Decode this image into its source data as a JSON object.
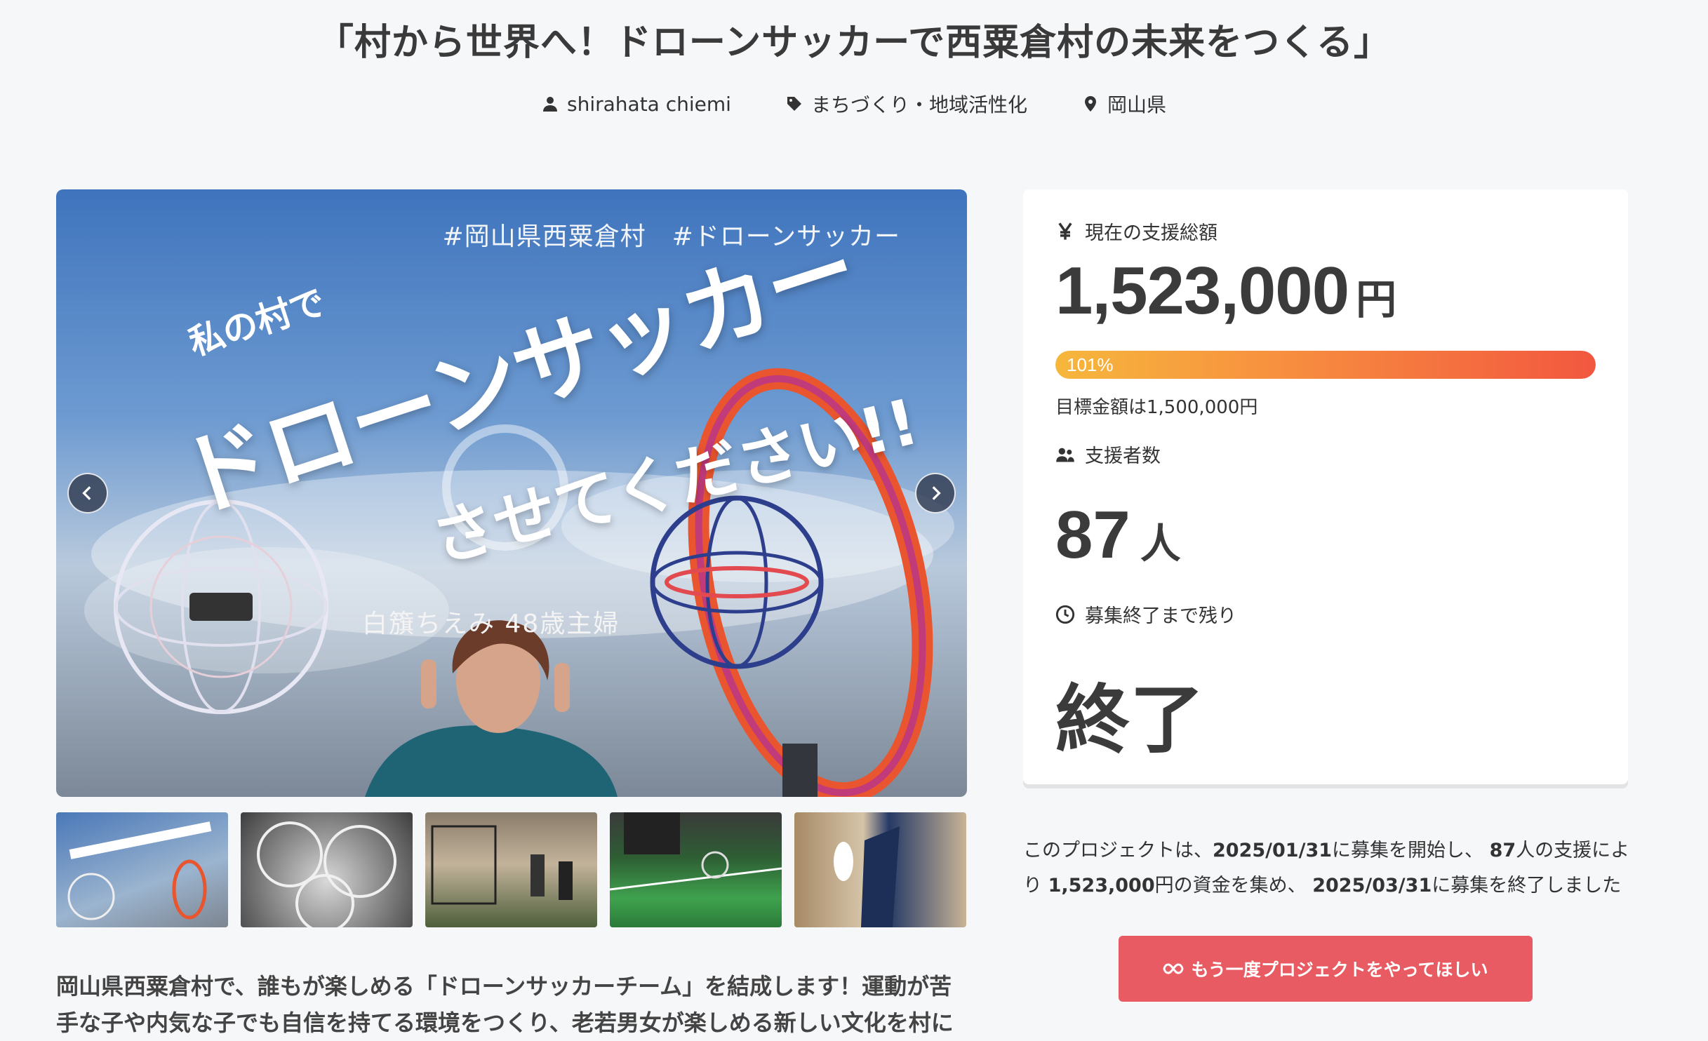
{
  "project": {
    "title": "「村から世界へ！ドローンサッカーで西粟倉村の未来をつくる」",
    "owner": "shirahata chiemi",
    "category": "まちづくり・地域活性化",
    "location": "岡山県"
  },
  "hero": {
    "tags": "#岡山県西粟倉村　#ドローンサッカー",
    "sub": "私の村で",
    "main": "ドローンサッカー",
    "main2": "させてください!!",
    "caption": "白籏ちえみ 48歳主婦",
    "prev_icon": "chevron-left-icon",
    "next_icon": "chevron-right-icon"
  },
  "thumbnails": [
    {
      "name": "thumbnail-1"
    },
    {
      "name": "thumbnail-2"
    },
    {
      "name": "thumbnail-3"
    },
    {
      "name": "thumbnail-4"
    },
    {
      "name": "thumbnail-5"
    }
  ],
  "description": "岡山県西粟倉村で、誰もが楽しめる「ドローンサッカーチーム」を結成します！運動が苦手な子や内気な子でも自信を持てる環境をつくり、老若男女が楽しめる新しい文化を村に",
  "stats": {
    "total_label": "現在の支援総額",
    "total_icon": "yen-icon",
    "total_value": "1,523,000",
    "total_unit": "円",
    "progress_percent": 101,
    "progress_label": "101%",
    "goal_text": "目標金額は1,500,000円",
    "backers_label": "支援者数",
    "backers_icon": "users-icon",
    "backers_value": "87",
    "backers_unit": "人",
    "remaining_label": "募集終了まで残り",
    "remaining_icon": "clock-icon",
    "remaining_value": "終了"
  },
  "summary": {
    "part1": "このプロジェクトは、",
    "start_date": "2025/01/31",
    "part2": "に募集を開始し、 ",
    "backers": "87",
    "part3": "人の支援により ",
    "amount": "1,523,000",
    "part4": "円の資金を集め、 ",
    "end_date": "2025/03/31",
    "part5": "に募集を終了しました"
  },
  "cta": {
    "label": "もう一度プロジェクトをやってほしい",
    "icon": "infinity-icon"
  },
  "colors": {
    "accent": "#e95b62",
    "progress_start": "#f6b73c",
    "progress_end": "#f2573f",
    "background": "#f6f7f9"
  }
}
